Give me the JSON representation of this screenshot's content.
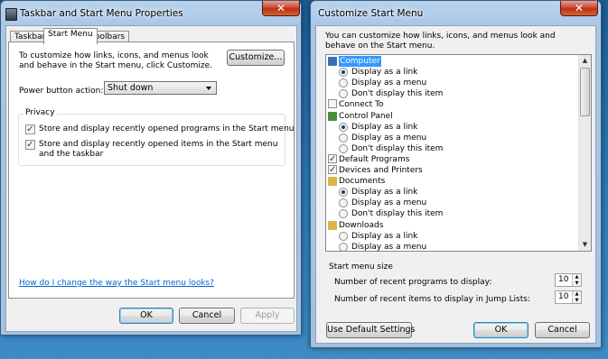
{
  "props_window": {
    "title": "Taskbar and Start Menu Properties",
    "close_glyph": "✕",
    "tabs": [
      "Taskbar",
      "Start Menu",
      "Toolbars"
    ],
    "customize_text": "To customize how links, icons, and menus look and behave in the Start menu, click Customize.",
    "customize_button": "Customize...",
    "power_label": "Power button action:",
    "power_value": "Shut down",
    "privacy_title": "Privacy",
    "privacy_items": [
      {
        "label": "Store and display recently opened programs in the Start menu",
        "checked": true
      },
      {
        "label": "Store and display recently opened items in the Start menu and the taskbar",
        "checked": true
      }
    ],
    "help_link": "How do I change the way the Start menu looks?",
    "buttons": {
      "ok": "OK",
      "cancel": "Cancel",
      "apply": "Apply"
    }
  },
  "customize_window": {
    "title": "Customize Start Menu",
    "close_glyph": "✕",
    "intro": "You can customize how links, icons, and menus look and behave on the Start menu.",
    "items": [
      {
        "type": "header",
        "label": "Computer",
        "icon": "computer-icon"
      },
      {
        "type": "radio",
        "label": "Display as a link",
        "checked": true
      },
      {
        "type": "radio",
        "label": "Display as a menu",
        "checked": false
      },
      {
        "type": "radio",
        "label": "Don't display this item",
        "checked": false
      },
      {
        "type": "checkbox",
        "label": "Connect To",
        "checked": false
      },
      {
        "type": "header",
        "label": "Control Panel",
        "icon": "control-panel-icon"
      },
      {
        "type": "radio",
        "label": "Display as a link",
        "checked": true
      },
      {
        "type": "radio",
        "label": "Display as a menu",
        "checked": false
      },
      {
        "type": "radio",
        "label": "Don't display this item",
        "checked": false
      },
      {
        "type": "checkbox",
        "label": "Default Programs",
        "checked": true
      },
      {
        "type": "checkbox",
        "label": "Devices and Printers",
        "checked": true
      },
      {
        "type": "header",
        "label": "Documents",
        "icon": "documents-icon"
      },
      {
        "type": "radio",
        "label": "Display as a link",
        "checked": true
      },
      {
        "type": "radio",
        "label": "Display as a menu",
        "checked": false
      },
      {
        "type": "radio",
        "label": "Don't display this item",
        "checked": false
      },
      {
        "type": "header",
        "label": "Downloads",
        "icon": "downloads-icon"
      },
      {
        "type": "radio",
        "label": "Display as a link",
        "checked": false
      },
      {
        "type": "radio",
        "label": "Display as a menu",
        "checked": false
      }
    ],
    "size_title": "Start menu size",
    "recent_programs_label": "Number of recent programs to display:",
    "recent_programs_value": "10",
    "recent_items_label": "Number of recent items to display in Jump Lists:",
    "recent_items_value": "10",
    "default_button": "Use Default Settings",
    "buttons": {
      "ok": "OK",
      "cancel": "Cancel"
    }
  }
}
